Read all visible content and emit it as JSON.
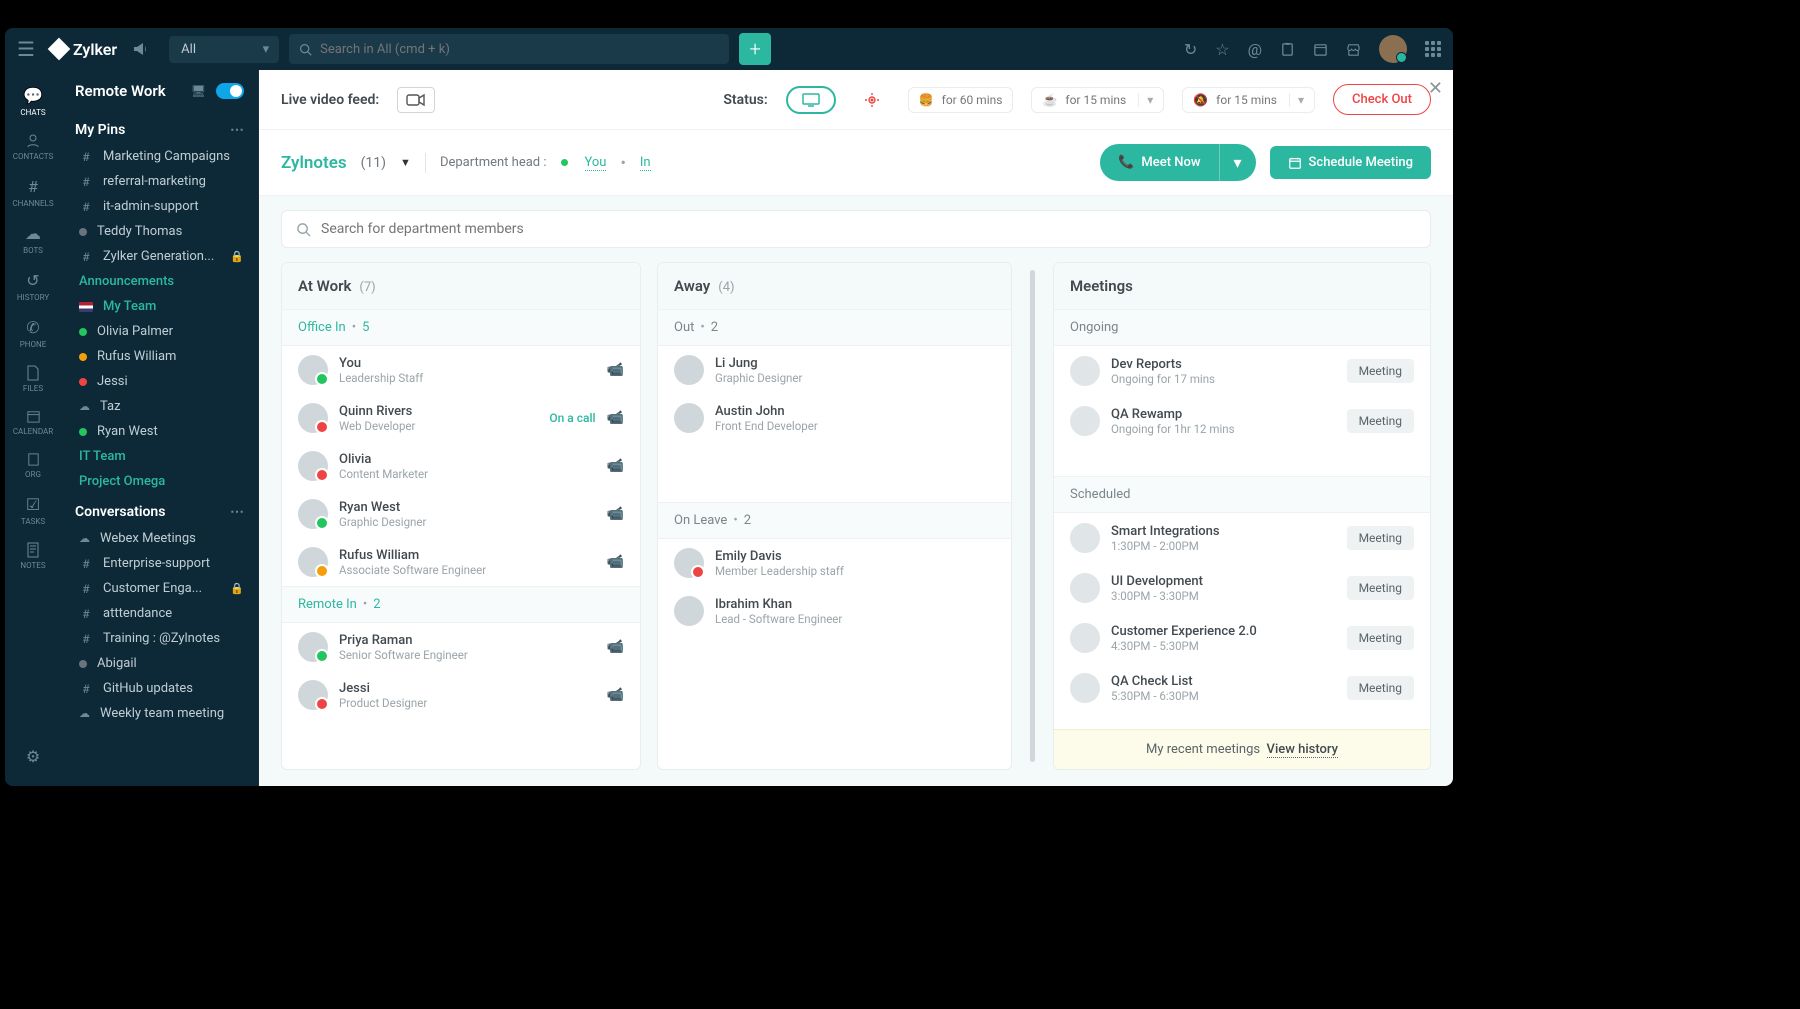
{
  "brand": "Zylker",
  "topbar": {
    "scope": "All",
    "search_placeholder": "Search in All (cmd + k)"
  },
  "rail": [
    {
      "label": "CHATS"
    },
    {
      "label": "CONTACTS"
    },
    {
      "label": "CHANNELS"
    },
    {
      "label": "BOTS"
    },
    {
      "label": "HISTORY"
    },
    {
      "label": "PHONE"
    },
    {
      "label": "FILES"
    },
    {
      "label": "CALENDAR"
    },
    {
      "label": "ORG"
    },
    {
      "label": "TASKS"
    },
    {
      "label": "NOTES"
    }
  ],
  "sidebar": {
    "title": "Remote Work",
    "pins_head": "My Pins",
    "pins": [
      {
        "icon": "#",
        "text": "Marketing Campaigns"
      },
      {
        "icon": "#",
        "text": "referral-marketing"
      },
      {
        "icon": "#",
        "text": "it-admin-support"
      },
      {
        "icon": "dot-gray",
        "text": "Teddy Thomas"
      },
      {
        "icon": "#",
        "text": "Zylker Generation...",
        "lock": true
      }
    ],
    "announcements": "Announcements",
    "myteam": "My Team",
    "team_members": [
      {
        "dot": "green",
        "text": "Olivia Palmer"
      },
      {
        "dot": "orange",
        "text": "Rufus William"
      },
      {
        "dot": "red",
        "text": "Jessi"
      },
      {
        "dot": "cloud",
        "text": "Taz"
      },
      {
        "dot": "green",
        "text": "Ryan West"
      }
    ],
    "it_team": "IT Team",
    "project_omega": "Project Omega",
    "conversations_head": "Conversations",
    "conversations": [
      {
        "icon": "cloud",
        "text": "Webex Meetings"
      },
      {
        "icon": "#",
        "text": "Enterprise-support"
      },
      {
        "icon": "#",
        "text": "Customer Enga...",
        "lock": true
      },
      {
        "icon": "#",
        "text": "atttendance"
      },
      {
        "icon": "#",
        "text": "Training : @Zylnotes"
      },
      {
        "icon": "dot-gray",
        "text": "Abigail"
      },
      {
        "icon": "#",
        "text": "GitHub updates"
      },
      {
        "icon": "cloud",
        "text": "Weekly team meeting"
      }
    ]
  },
  "toolbar": {
    "video_feed": "Live video feed:",
    "status": "Status:",
    "away_60": "for 60 mins",
    "away_15a": "for 15 mins",
    "away_15b": "for 15 mins",
    "checkout": "Check Out"
  },
  "dept": {
    "name": "Zylnotes",
    "count": "(11)",
    "head_label": "Department head :",
    "head_you": "You",
    "head_status": "In",
    "meet_now": "Meet Now",
    "schedule": "Schedule Meeting",
    "search_placeholder": "Search for department members"
  },
  "work": {
    "title": "At Work",
    "count": "(7)",
    "office_in": "Office In",
    "office_count": "5",
    "remote_in": "Remote In",
    "remote_count": "2",
    "office": [
      {
        "name": "You",
        "role": "Leadership Staff",
        "st": "green"
      },
      {
        "name": "Quinn Rivers",
        "role": "Web Developer",
        "st": "red",
        "status": "On a call"
      },
      {
        "name": "Olivia",
        "role": "Content Marketer",
        "st": "red"
      },
      {
        "name": "Ryan West",
        "role": "Graphic Designer",
        "st": "green"
      },
      {
        "name": "Rufus William",
        "role": "Associate Software Engineer",
        "st": "orange"
      }
    ],
    "remote": [
      {
        "name": "Priya Raman",
        "role": "Senior Software Engineer",
        "st": "green"
      },
      {
        "name": "Jessi",
        "role": "Product Designer",
        "st": "red"
      }
    ]
  },
  "away": {
    "title": "Away",
    "count": "(4)",
    "out": "Out",
    "out_count": "2",
    "leave": "On Leave",
    "leave_count": "2",
    "out_list": [
      {
        "name": "Li Jung",
        "role": "Graphic Designer"
      },
      {
        "name": "Austin John",
        "role": "Front End Developer"
      }
    ],
    "leave_list": [
      {
        "name": "Emily Davis",
        "role": "Member Leadership staff",
        "st": "red"
      },
      {
        "name": "Ibrahim Khan",
        "role": "Lead - Software Engineer"
      }
    ]
  },
  "meetings": {
    "title": "Meetings",
    "ongoing": "Ongoing",
    "scheduled": "Scheduled",
    "btn": "Meeting",
    "ongoing_list": [
      {
        "name": "Dev Reports",
        "time": "Ongoing for 17 mins"
      },
      {
        "name": "QA Rewamp",
        "time": "Ongoing for 1hr 12 mins"
      }
    ],
    "scheduled_list": [
      {
        "name": "Smart Integrations",
        "time": "1:30PM - 2:00PM"
      },
      {
        "name": "UI Development",
        "time": "3:00PM - 3:30PM"
      },
      {
        "name": "Customer Experience 2.0",
        "time": "4:30PM - 5:30PM"
      },
      {
        "name": "QA Check List",
        "time": "5:30PM - 6:30PM"
      }
    ],
    "footer_text": "My recent meetings",
    "footer_link": "View history"
  }
}
